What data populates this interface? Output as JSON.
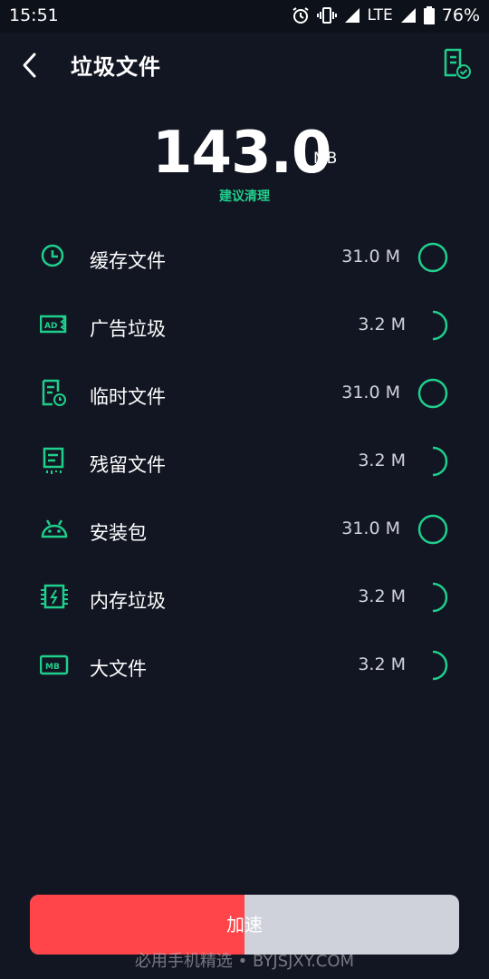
{
  "status_bar": {
    "time": "15:51",
    "network": "LTE",
    "battery": "76%"
  },
  "header": {
    "title": "垃圾文件"
  },
  "summary": {
    "value": "143.0",
    "unit": "MB",
    "advice": "建议清理"
  },
  "items": [
    {
      "label": "缓存文件",
      "size": "31.0 M",
      "icon": "clock-icon",
      "state": "checked"
    },
    {
      "label": "广告垃圾",
      "size": "3.2 M",
      "icon": "ad-icon",
      "state": "loading"
    },
    {
      "label": "临时文件",
      "size": "31.0 M",
      "icon": "temp-file-icon",
      "state": "checked"
    },
    {
      "label": "残留文件",
      "size": "3.2 M",
      "icon": "residual-file-icon",
      "state": "loading"
    },
    {
      "label": "安装包",
      "size": "31.0 M",
      "icon": "android-icon",
      "state": "checked"
    },
    {
      "label": "内存垃圾",
      "size": "3.2 M",
      "icon": "memory-chip-icon",
      "state": "loading"
    },
    {
      "label": "大文件",
      "size": "3.2 M",
      "icon": "mb-icon",
      "state": "loading"
    }
  ],
  "action": {
    "label": "加速",
    "progress": 0.5
  },
  "watermark": "必用手机精选 • BYJSJXY.COM",
  "colors": {
    "accent": "#1fcf8c",
    "background": "#121622",
    "button_fill": "#ff4549",
    "button_track": "#cfd2db"
  }
}
